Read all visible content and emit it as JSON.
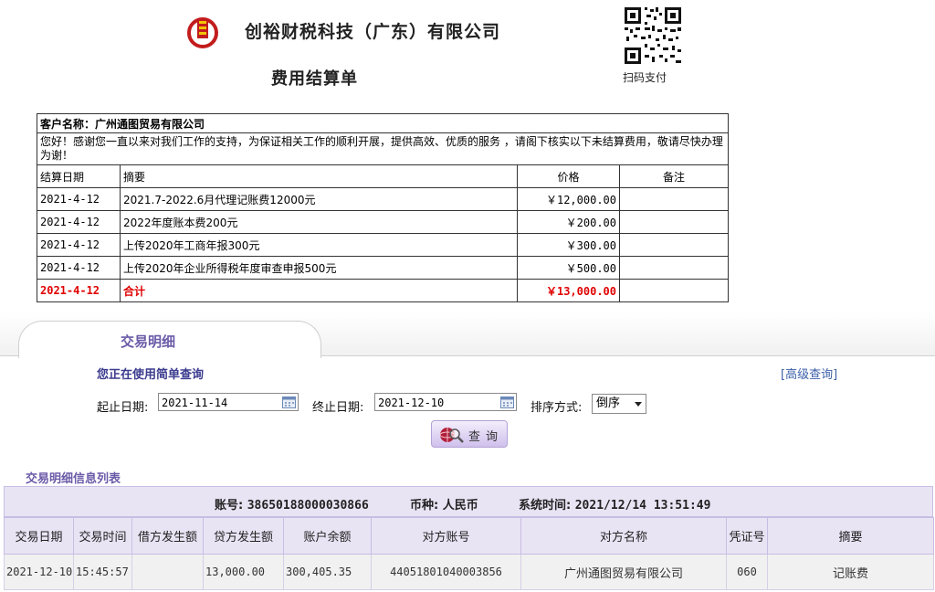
{
  "header": {
    "company": "创裕财税科技（广东）有限公司",
    "title": "费用结算单",
    "qr_label": "扫码支付"
  },
  "invoice": {
    "customer_label": "客户名称：广州通图贸易有限公司",
    "greeting": "您好！感谢您一直以来对我们工作的支持，为保证相关工作的顺利开展，提供高效、优质的服务 ，请阁下核实以下未结算费用，敬请尽快办理为谢！",
    "columns": [
      "结算日期",
      "摘要",
      "价格",
      "备注"
    ],
    "rows": [
      {
        "date": "2021-4-12",
        "desc": "2021.7-2022.6月代理记账费12000元",
        "price": "￥12,000.00",
        "note": ""
      },
      {
        "date": "2021-4-12",
        "desc": "2022年度账本费200元",
        "price": "￥200.00",
        "note": ""
      },
      {
        "date": "2021-4-12",
        "desc": "上传2020年工商年报300元",
        "price": "￥300.00",
        "note": ""
      },
      {
        "date": "2021-4-12",
        "desc": "上传2020年企业所得税年度审查申报500元",
        "price": "￥500.00",
        "note": ""
      }
    ],
    "total": {
      "date": "2021-4-12",
      "desc": "合计",
      "price": "￥13,000.00",
      "note": ""
    }
  },
  "bank": {
    "tab_label": "交易明细",
    "simple_query": "您正在使用简单查询",
    "advanced_query": "[高级查询]",
    "start_label": "起止日期:",
    "start_value": "2021-11-14",
    "end_label": "终止日期:",
    "end_value": "2021-12-10",
    "sort_label": "排序方式:",
    "sort_value": "倒序",
    "query_button": "查询",
    "list_title": "交易明细信息列表",
    "account_label": "账号:",
    "account_value": "38650188000030866",
    "currency_label": "币种:",
    "currency_value": "人民币",
    "systime_label": "系统时间:",
    "systime_value": "2021/12/14 13:51:49",
    "columns": [
      "交易日期",
      "交易时间",
      "借方发生额",
      "贷方发生额",
      "账户余额",
      "对方账号",
      "对方名称",
      "凭证号",
      "摘要"
    ],
    "rows": [
      {
        "date": "2021-12-10",
        "time": "15:45:57",
        "debit": "",
        "credit": "13,000.00",
        "balance": "300,405.35",
        "counter_account": "44051801040003856",
        "counter_name": "广州通图贸易有限公司",
        "voucher": "060",
        "summary": "记账费"
      }
    ]
  },
  "colors": {
    "accent": "#6b5aa8",
    "total_red": "#e00000",
    "header_bg": "#e9e4f4"
  }
}
